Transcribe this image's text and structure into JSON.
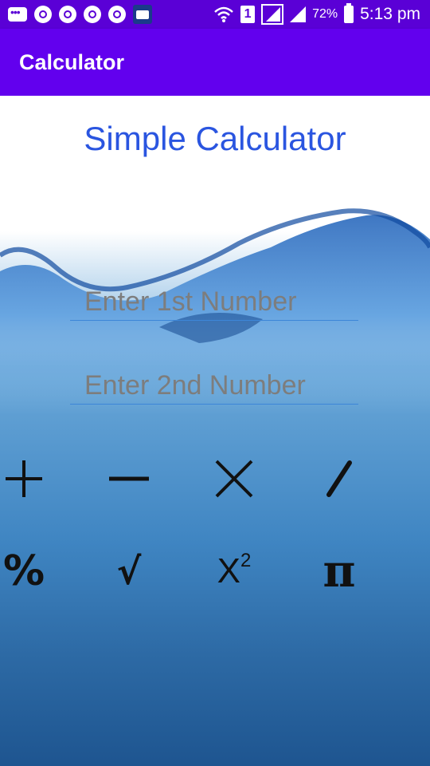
{
  "status_bar": {
    "battery": "72%",
    "time": "5:13 pm",
    "sim_slot": "1",
    "icons": [
      "message-icon",
      "aperture-icon",
      "aperture-icon",
      "aperture-icon",
      "aperture-icon",
      "book-icon",
      "wifi-icon",
      "sim-icon",
      "signal-icon",
      "signal-icon",
      "battery-icon"
    ]
  },
  "app_bar": {
    "title": "Calculator"
  },
  "main": {
    "title": "Simple Calculator",
    "first_number": {
      "value": "",
      "placeholder": "Enter 1st Number"
    },
    "second_number": {
      "value": "",
      "placeholder": "Enter 2nd Number"
    }
  },
  "operations": [
    {
      "name": "add",
      "symbol": "+",
      "icon": "plus-icon"
    },
    {
      "name": "subtract",
      "symbol": "−",
      "icon": "minus-icon"
    },
    {
      "name": "multiply",
      "symbol": "×",
      "icon": "multiply-icon"
    },
    {
      "name": "divide",
      "symbol": "/",
      "icon": "divide-icon"
    },
    {
      "name": "percent",
      "symbol": "%",
      "icon": "percent-icon"
    },
    {
      "name": "square-root",
      "symbol": "√",
      "icon": "square-root-icon"
    },
    {
      "name": "square",
      "symbol": "X",
      "superscript": "2",
      "icon": "square-icon"
    },
    {
      "name": "pi",
      "symbol": "π",
      "icon": "pi-icon"
    }
  ],
  "colors": {
    "status_bar": "#5a00d6",
    "app_bar": "#6200ee",
    "title_text": "#2a55e0",
    "field_underline": "#3d86d8"
  }
}
